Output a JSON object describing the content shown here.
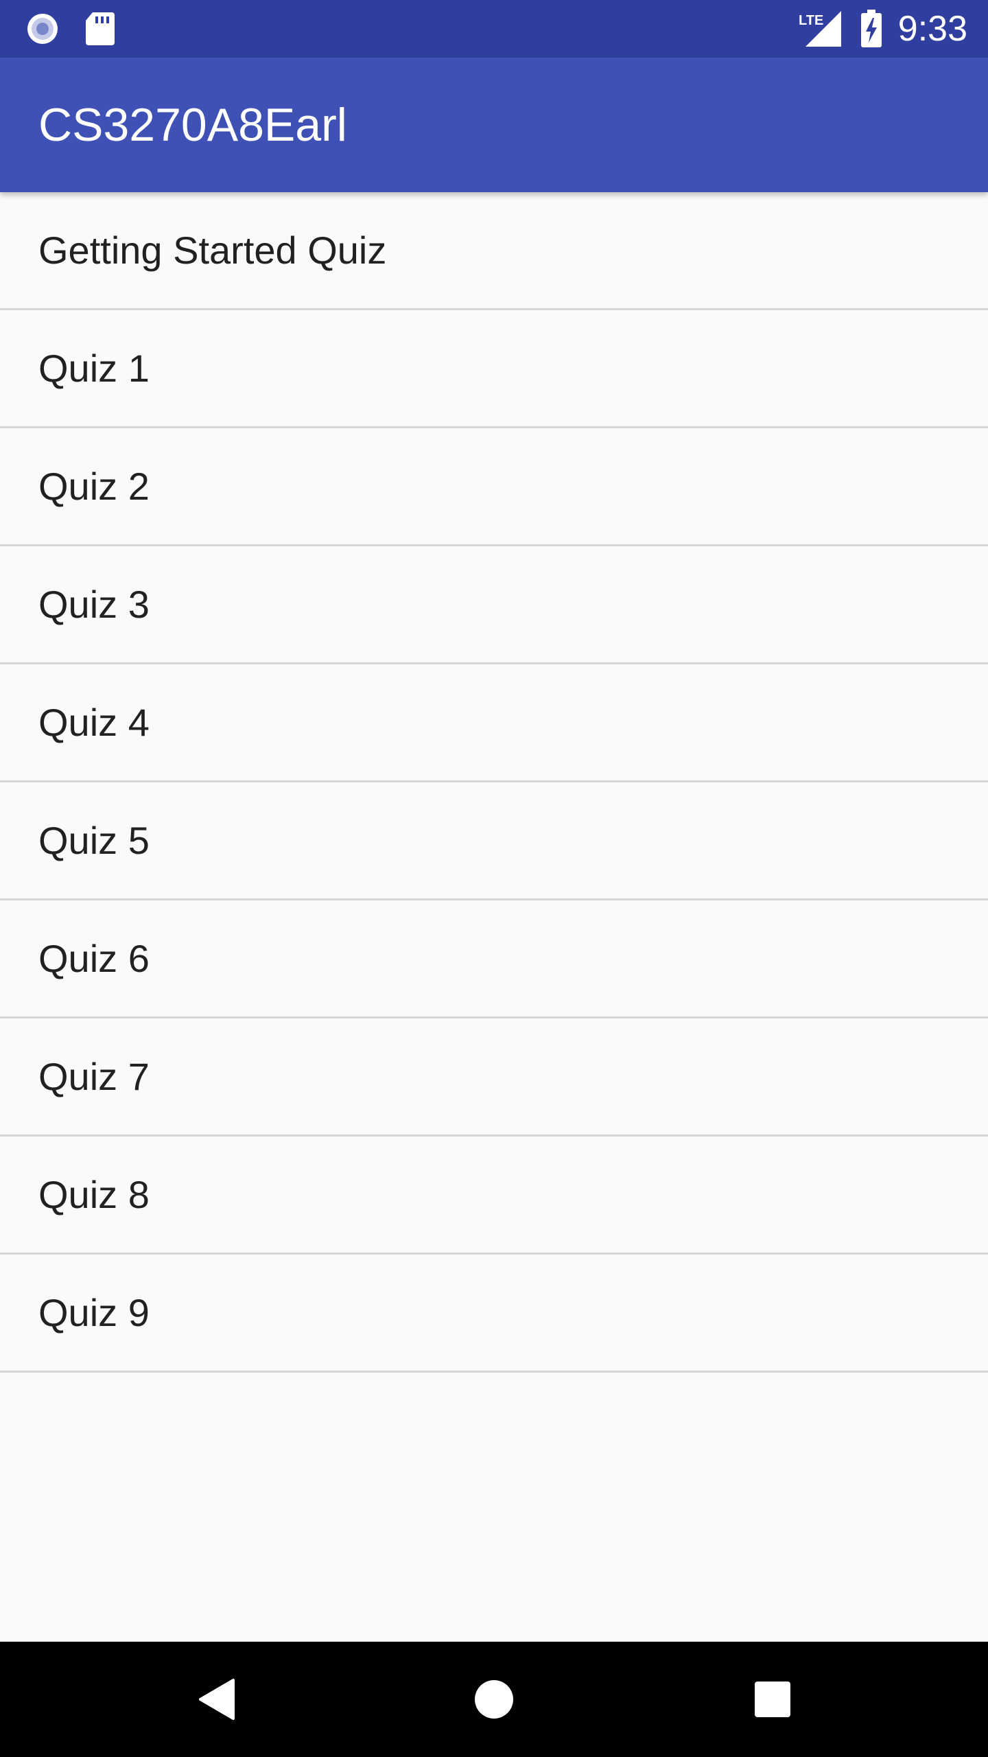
{
  "status_bar": {
    "time": "9:33",
    "left_icons": [
      "record-icon",
      "sd-card-icon"
    ],
    "right_icons": [
      "lte-signal-icon",
      "battery-charging-icon"
    ],
    "network_label": "LTE",
    "background": "#303F9F"
  },
  "app_bar": {
    "title": "CS3270A8Earl",
    "background": "#3F51B5"
  },
  "quizzes": [
    {
      "label": "Getting Started Quiz"
    },
    {
      "label": "Quiz 1"
    },
    {
      "label": "Quiz 2"
    },
    {
      "label": "Quiz 3"
    },
    {
      "label": "Quiz 4"
    },
    {
      "label": "Quiz 5"
    },
    {
      "label": "Quiz 6"
    },
    {
      "label": "Quiz 7"
    },
    {
      "label": "Quiz 8"
    },
    {
      "label": "Quiz 9"
    }
  ],
  "nav_bar": {
    "buttons": [
      "back-icon",
      "home-icon",
      "recents-icon"
    ]
  }
}
